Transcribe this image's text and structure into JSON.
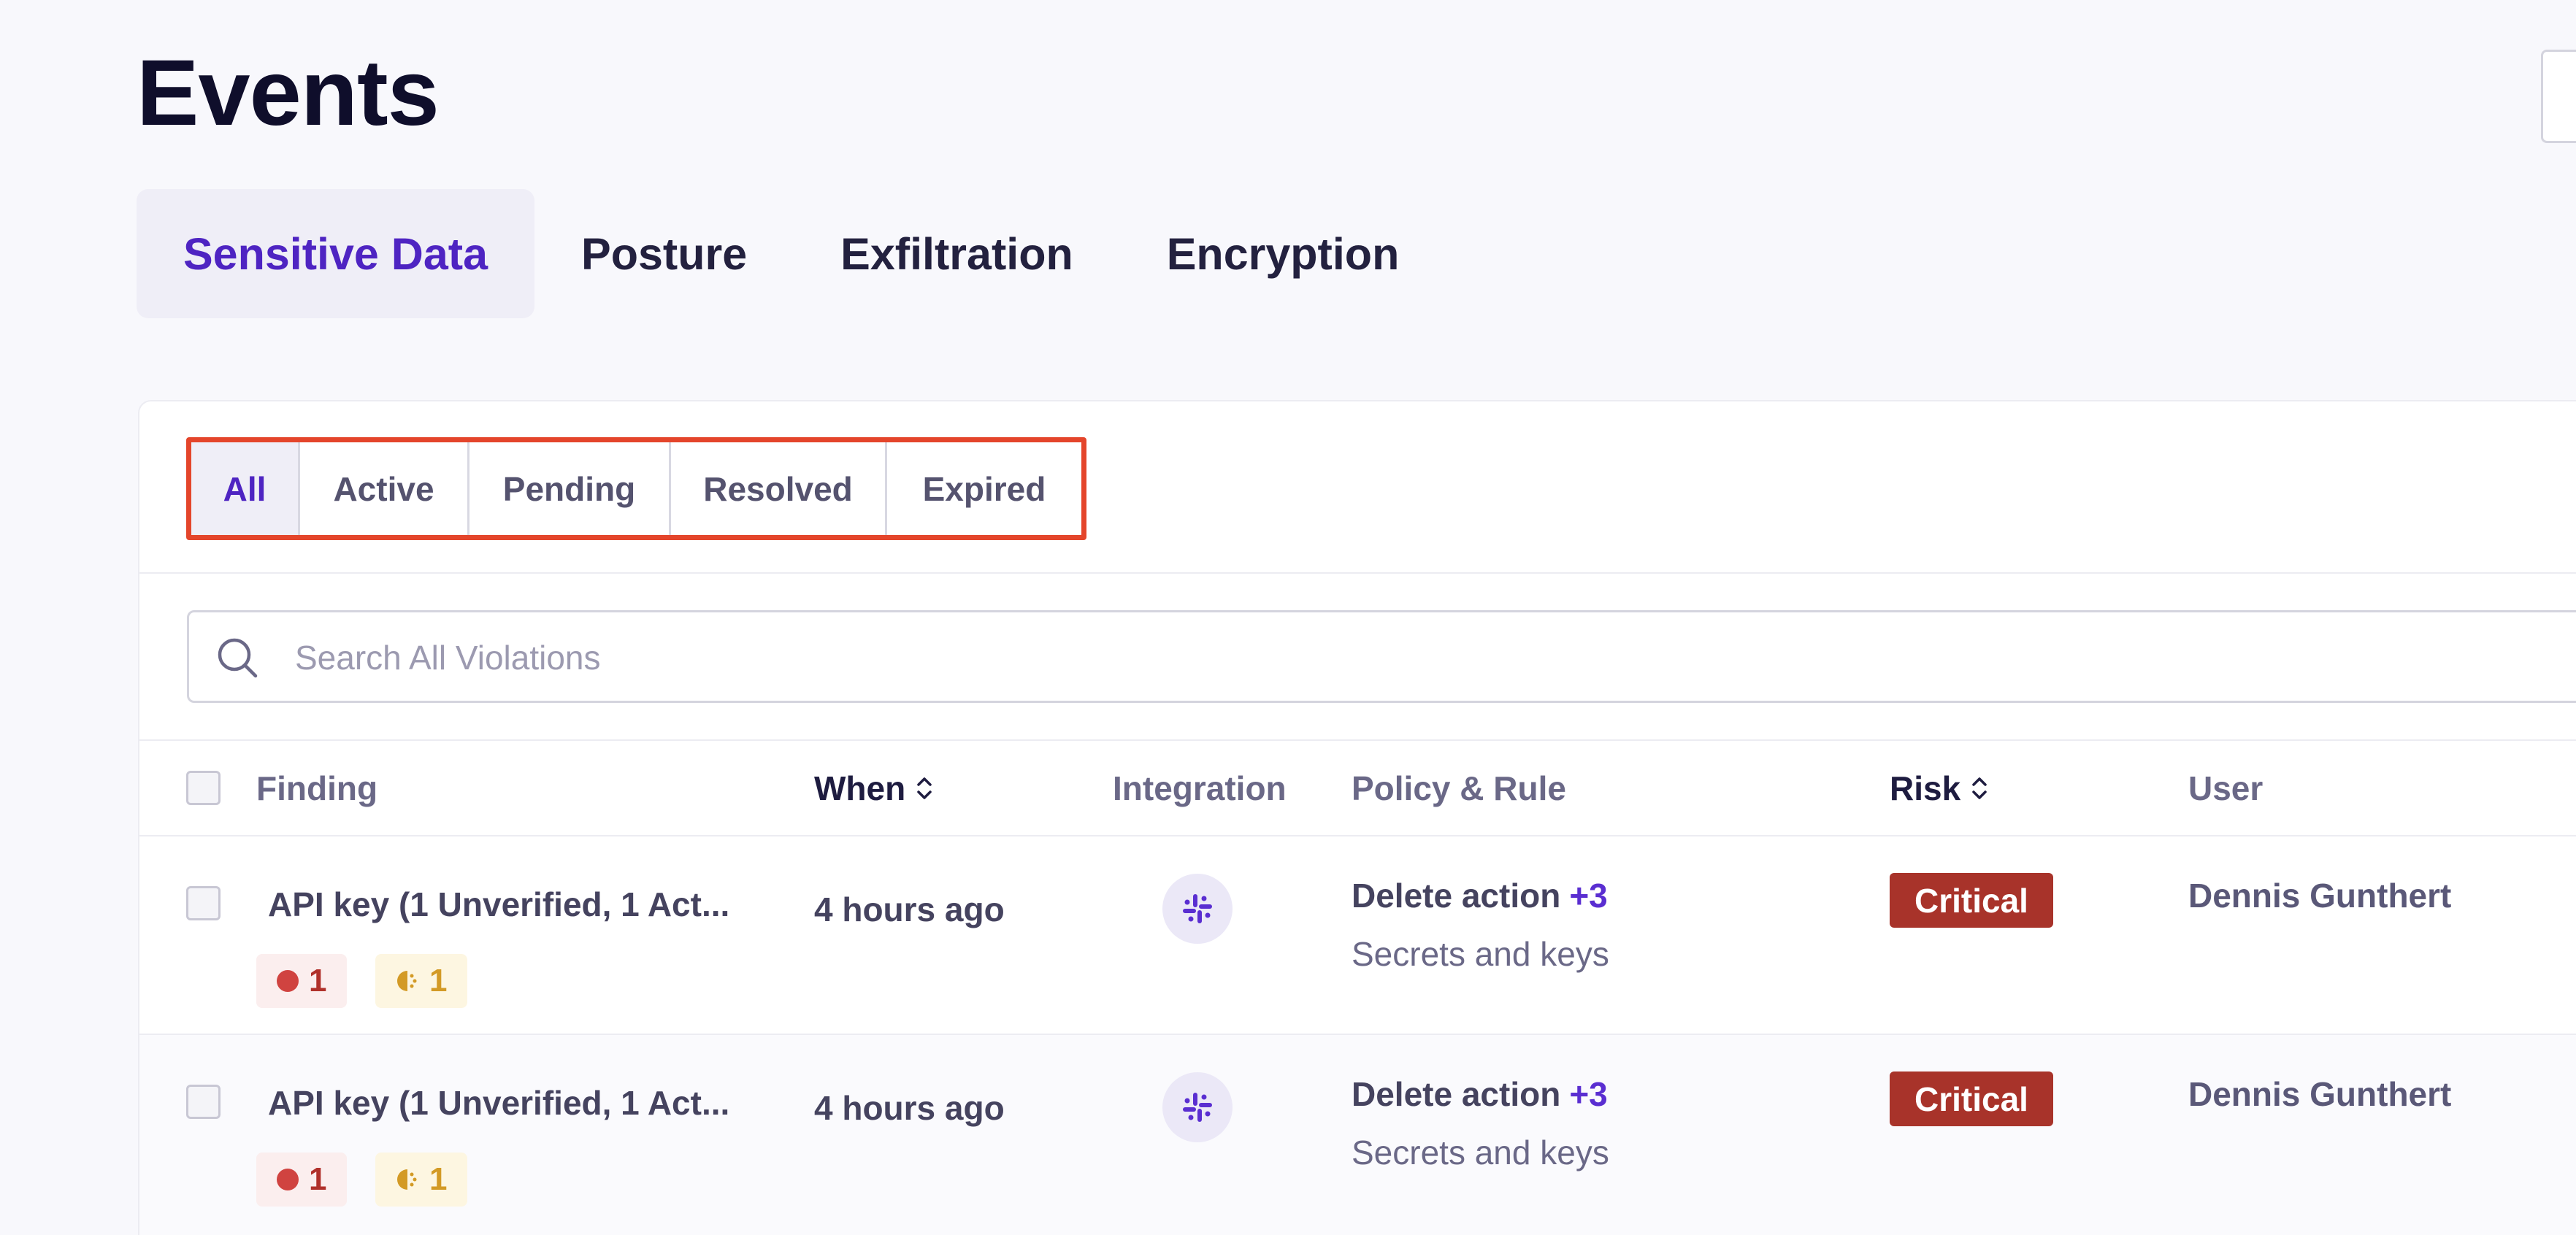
{
  "page": {
    "title": "Events"
  },
  "tabs": [
    {
      "label": "Sensitive Data",
      "active": true
    },
    {
      "label": "Posture",
      "active": false
    },
    {
      "label": "Exfiltration",
      "active": false
    },
    {
      "label": "Encryption",
      "active": false
    }
  ],
  "status_filter": [
    {
      "label": "All",
      "active": true
    },
    {
      "label": "Active",
      "active": false
    },
    {
      "label": "Pending",
      "active": false
    },
    {
      "label": "Resolved",
      "active": false
    },
    {
      "label": "Expired",
      "active": false
    }
  ],
  "search": {
    "placeholder": "Search All Violations",
    "value": ""
  },
  "table": {
    "columns": {
      "finding": "Finding",
      "when": "When",
      "integration": "Integration",
      "policy_rule": "Policy & Rule",
      "risk": "Risk",
      "user": "User"
    },
    "rows": [
      {
        "finding": "API key (1 Unverified, 1 Act...",
        "critical_count": "1",
        "warning_count": "1",
        "when": "4 hours ago",
        "integration_icon": "slack-icon",
        "policy": "Delete action",
        "policy_more": "+3",
        "rule": "Secrets and keys",
        "risk": "Critical",
        "user": "Dennis Gunthert"
      },
      {
        "finding": "API key (1 Unverified, 1 Act...",
        "critical_count": "1",
        "warning_count": "1",
        "when": "4 hours ago",
        "integration_icon": "slack-icon",
        "policy": "Delete action",
        "policy_more": "+3",
        "rule": "Secrets and keys",
        "risk": "Critical",
        "user": "Dennis Gunthert"
      }
    ]
  },
  "colors": {
    "accent": "#4e24c2",
    "critical": "#a8332a",
    "highlight": "#e4452b"
  }
}
